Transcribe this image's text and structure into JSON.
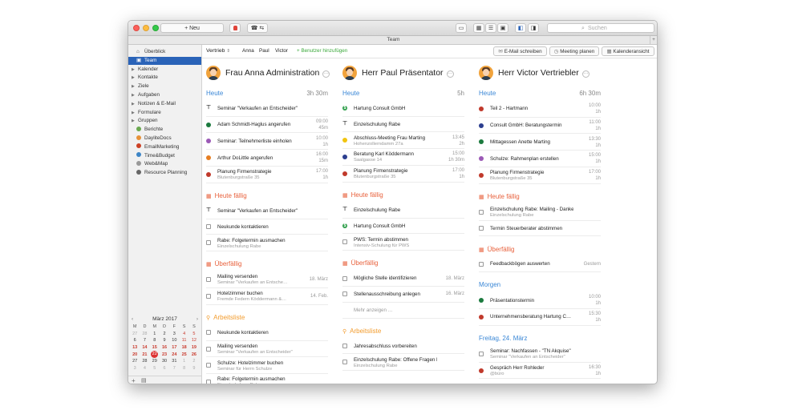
{
  "toolbar": {
    "new_label": "+ Neu",
    "search_placeholder": "Suchen"
  },
  "window_title": "Team",
  "sidebar": {
    "items": [
      {
        "label": "Überblick",
        "icon": "home-icon",
        "type": "icon",
        "color": "#7a7a7a"
      },
      {
        "label": "Team",
        "icon": "team-icon",
        "type": "icon",
        "selected": true,
        "color": "#ffffff"
      },
      {
        "label": "Kalender",
        "type": "group"
      },
      {
        "label": "Kontakte",
        "type": "group"
      },
      {
        "label": "Ziele",
        "type": "group"
      },
      {
        "label": "Aufgaben",
        "type": "group"
      },
      {
        "label": "Notizen & E-Mail",
        "type": "group"
      },
      {
        "label": "Formulare",
        "type": "group"
      },
      {
        "label": "Gruppen",
        "type": "group"
      },
      {
        "label": "Berichte",
        "type": "app",
        "color": "#6aa84f"
      },
      {
        "label": "DaylitеDocs",
        "type": "app",
        "color": "#e69138"
      },
      {
        "label": "EmailMarketing",
        "type": "app",
        "color": "#cc4125"
      },
      {
        "label": "Time&Budget",
        "type": "app",
        "color": "#3d85c6"
      },
      {
        "label": "Web&Map",
        "type": "app",
        "color": "#999999"
      },
      {
        "label": "Resource Planning",
        "type": "app",
        "color": "#666666"
      }
    ],
    "calendar": {
      "month_label": "März 2017",
      "weekdays": [
        "M",
        "D",
        "M",
        "D",
        "F",
        "S",
        "S"
      ],
      "weeks": [
        [
          "27",
          "28",
          "1",
          "2",
          "3",
          "4",
          "5"
        ],
        [
          "6",
          "7",
          "8",
          "9",
          "10",
          "11",
          "12"
        ],
        [
          "13",
          "14",
          "15",
          "16",
          "17",
          "18",
          "19"
        ],
        [
          "20",
          "21",
          "22",
          "23",
          "24",
          "25",
          "26"
        ],
        [
          "27",
          "28",
          "29",
          "30",
          "31",
          "1",
          "2"
        ],
        [
          "3",
          "4",
          "5",
          "6",
          "7",
          "8",
          "9"
        ]
      ],
      "today": "22"
    }
  },
  "subtoolbar": {
    "group_select": "Vertrieb",
    "users": [
      "Anna",
      "Paul",
      "Victor"
    ],
    "add_user": "Benutzer hinzufügen",
    "email_button": "E-Mail schreiben",
    "meeting_button": "Meeting planen",
    "calendar_button": "Kalenderansicht"
  },
  "columns": [
    {
      "name": "Frau Anna Administration",
      "sections": [
        {
          "title": "Heute",
          "color": "blue",
          "right": "3h 30m",
          "items": [
            {
              "icon": "pin",
              "t1": "Seminar \"Verkaufen an Entscheider\"",
              "t2": "",
              "r1": "",
              "r2": ""
            },
            {
              "icon": "dot",
              "color": "#1b7a3e",
              "t1": "Adam Schmidt-Haglus angerufen",
              "t2": "",
              "r1": "09:00",
              "r2": "45m"
            },
            {
              "icon": "dot",
              "color": "#9b59b6",
              "t1": "Seminar: Teilnehmerliste einholen",
              "t2": "",
              "r1": "10:00",
              "r2": "1h"
            },
            {
              "icon": "dot",
              "color": "#e67e22",
              "t1": "Arthur DoLittle angerufen",
              "t2": "",
              "r1": "16:00",
              "r2": "15m"
            },
            {
              "icon": "dot",
              "color": "#c0392b",
              "t1": "Planung Firmenstrategie",
              "t2": "Blutenburgstraße 35",
              "r1": "17:00",
              "r2": "1h"
            }
          ]
        },
        {
          "title": "Heute fällig",
          "color": "red",
          "right": "",
          "items": [
            {
              "icon": "pin",
              "t1": "Seminar \"Verkaufen an Entscheider\"",
              "t2": "",
              "r1": "",
              "r2": ""
            },
            {
              "icon": "check",
              "t1": "Neukunde kontaktieren",
              "t2": "",
              "r1": "",
              "r2": ""
            },
            {
              "icon": "check",
              "t1": "Rabe: Folgetermin ausmachen",
              "t2": "Einzelschulung Rabe",
              "r1": "",
              "r2": ""
            }
          ]
        },
        {
          "title": "Überfällig",
          "color": "red",
          "right": "",
          "items": [
            {
              "icon": "check",
              "t1": "Mailing versenden",
              "t2": "Seminar \"Verkaufen an Entsche…",
              "r1": "18. März",
              "r2": ""
            },
            {
              "icon": "check",
              "t1": "Hotelzimmer buchen",
              "t2": "Fremde Federn Köddermann &…",
              "r1": "14. Feb.",
              "r2": ""
            }
          ]
        },
        {
          "title": "Arbeitsliste",
          "color": "orange",
          "right": "",
          "items": [
            {
              "icon": "check",
              "t1": "Neukunde kontaktieren",
              "t2": "",
              "r1": "",
              "r2": ""
            },
            {
              "icon": "check",
              "t1": "Mailing versenden",
              "t2": "Seminar \"Verkaufen an Entscheider\"",
              "r1": "",
              "r2": ""
            },
            {
              "icon": "check",
              "t1": "Schulze: Hotelzimmer buchen",
              "t2": "Seminar für Herrn Schulze",
              "r1": "",
              "r2": ""
            },
            {
              "icon": "check",
              "t1": "Rabe: Folgetermin ausmachen",
              "t2": "Einzelschulung Rabe",
              "r1": "",
              "r2": ""
            }
          ]
        }
      ]
    },
    {
      "name": "Herr Paul Präsentator",
      "sections": [
        {
          "title": "Heute",
          "color": "blue",
          "right": "5h",
          "items": [
            {
              "icon": "dollar",
              "t1": "Hartung Consult GmbH",
              "t2": "",
              "r1": "",
              "r2": ""
            },
            {
              "icon": "pin",
              "t1": "Einzelschulung Rabe",
              "t2": "",
              "r1": "",
              "r2": ""
            },
            {
              "icon": "dot",
              "color": "#f1c40f",
              "t1": "Abschluss-Meeting Frau Marting",
              "t2": "Hohenzollerndamm 27a",
              "r1": "13:45",
              "r2": "2h"
            },
            {
              "icon": "dot",
              "color": "#2c3e8f",
              "t1": "Beratung Karl Köddermann",
              "t2": "Saalgasse 14",
              "r1": "15:00",
              "r2": "1h 30m"
            },
            {
              "icon": "dot",
              "color": "#c0392b",
              "t1": "Planung Firmenstrategie",
              "t2": "Blutenburgstraße 35",
              "r1": "17:00",
              "r2": "1h"
            }
          ]
        },
        {
          "title": "Heute fällig",
          "color": "red",
          "right": "",
          "items": [
            {
              "icon": "pin",
              "t1": "Einzelschulung Rabe",
              "t2": "",
              "r1": "",
              "r2": ""
            },
            {
              "icon": "dollar",
              "t1": "Hartung Consult GmbH",
              "t2": "",
              "r1": "",
              "r2": ""
            },
            {
              "icon": "check",
              "t1": "PWS: Termin abstimmen",
              "t2": "Intensiv-Schulung für PWS",
              "r1": "",
              "r2": ""
            }
          ]
        },
        {
          "title": "Überfällig",
          "color": "red",
          "right": "",
          "items": [
            {
              "icon": "check",
              "t1": "Mögliche Stelle identifizieren",
              "t2": "",
              "r1": "18. März",
              "r2": ""
            },
            {
              "icon": "check",
              "t1": "Stellenausschreibung anlegen",
              "t2": "",
              "r1": "16. März",
              "r2": ""
            },
            {
              "icon": "none",
              "t1": "Mehr anzeigen …",
              "t2": "",
              "r1": "",
              "r2": "",
              "muted": true
            }
          ]
        },
        {
          "title": "Arbeitsliste",
          "color": "orange",
          "right": "",
          "items": [
            {
              "icon": "check",
              "t1": "Jahresabschluss vorbereiten",
              "t2": "",
              "r1": "",
              "r2": ""
            },
            {
              "icon": "check",
              "t1": "Einzelschulung Rabe: Offene Fragen beant…",
              "t2": "Einzelschulung Rabe",
              "r1": "",
              "r2": ""
            }
          ]
        }
      ]
    },
    {
      "name": "Herr Victor Vertriebler",
      "sections": [
        {
          "title": "Heute",
          "color": "blue",
          "right": "6h 30m",
          "items": [
            {
              "icon": "dot",
              "color": "#c0392b",
              "t1": "Teil 2 - Hartmann",
              "t2": "",
              "r1": "10:00",
              "r2": "1h"
            },
            {
              "icon": "dot",
              "color": "#2c3e8f",
              "t1": "Consult GmbH: Beratungstermin",
              "t2": "",
              "r1": "11:00",
              "r2": "1h"
            },
            {
              "icon": "dot",
              "color": "#1b7a3e",
              "t1": "Mittagessen Anette Marting",
              "t2": "",
              "r1": "13:30",
              "r2": "1h"
            },
            {
              "icon": "dot",
              "color": "#9b59b6",
              "t1": "Schulze: Rahmenplan erstellen",
              "t2": "",
              "r1": "15:00",
              "r2": "1h"
            },
            {
              "icon": "dot",
              "color": "#c0392b",
              "t1": "Planung Firmenstrategie",
              "t2": "Blutenburgstraße 35",
              "r1": "17:00",
              "r2": "1h"
            }
          ]
        },
        {
          "title": "Heute fällig",
          "color": "red",
          "right": "",
          "items": [
            {
              "icon": "check",
              "t1": "Einzelschulung Rabe: Mailing - Danke",
              "t2": "Einzelschulung Rabe",
              "r1": "",
              "r2": ""
            },
            {
              "icon": "check",
              "t1": "Termin Steuerberater abstimmen",
              "t2": "",
              "r1": "",
              "r2": ""
            }
          ]
        },
        {
          "title": "Überfällig",
          "color": "red",
          "right": "",
          "items": [
            {
              "icon": "check",
              "t1": "Feedbackbögen auswerten",
              "t2": "",
              "r1": "Gestern",
              "r2": ""
            }
          ]
        },
        {
          "title": "Morgen",
          "color": "blue",
          "right": "",
          "items": [
            {
              "icon": "dot",
              "color": "#1b7a3e",
              "t1": "Präsentationstermin",
              "t2": "",
              "r1": "10:00",
              "r2": "1h"
            },
            {
              "icon": "dot",
              "color": "#c0392b",
              "t1": "Unternehmensberatung Hartung C…",
              "t2": "",
              "r1": "15:30",
              "r2": "1h"
            }
          ]
        },
        {
          "title": "Freitag, 24. März",
          "color": "blue",
          "right": "",
          "items": [
            {
              "icon": "check",
              "t1": "Seminar: Nachfassen - \"TN Akquise\"",
              "t2": "Seminar \"Verkaufen an Entscheider\"",
              "r1": "",
              "r2": ""
            },
            {
              "icon": "dot",
              "color": "#c0392b",
              "t1": "Gespräch Herr Rohleder",
              "t2": "@büro",
              "r1": "16:30",
              "r2": "1h"
            }
          ]
        }
      ]
    }
  ]
}
